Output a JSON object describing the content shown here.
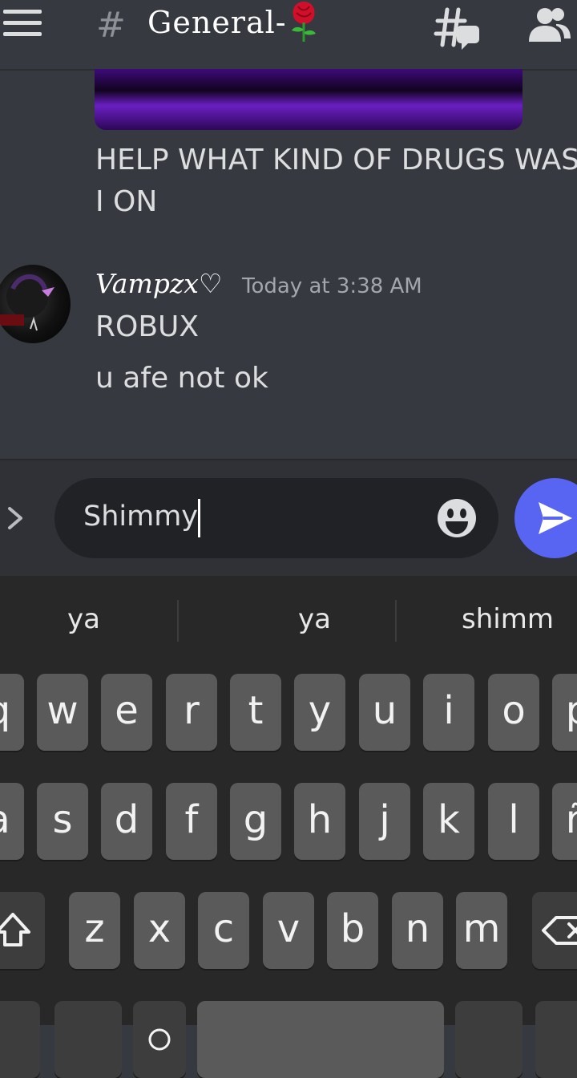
{
  "header": {
    "hash_symbol": "#",
    "channel_name": "General-",
    "rose_icon": "rose-emoji",
    "threads_icon": "threads-icon",
    "members_icon": "members-icon"
  },
  "messages": {
    "prev_line1": "HELP WHAT KIND OF DRUGS WAS",
    "prev_line2": "I ON",
    "author": "Vampzx♡",
    "timestamp": "Today at 3:38 AM",
    "line1": "ROBUX",
    "line2": "u afe not ok"
  },
  "composer": {
    "text": "Shimmy",
    "emoji_icon": "smile-icon",
    "send_icon": "send-icon"
  },
  "keyboard": {
    "suggestions": [
      "ya",
      "ya",
      "shimm"
    ],
    "row1": [
      "q",
      "w",
      "e",
      "r",
      "t",
      "y",
      "u",
      "i",
      "o",
      "p"
    ],
    "row2": [
      "a",
      "s",
      "d",
      "f",
      "g",
      "h",
      "j",
      "k",
      "l",
      "ñ"
    ],
    "row3": [
      "z",
      "x",
      "c",
      "v",
      "b",
      "n",
      "m"
    ]
  },
  "colors": {
    "background": "#36393f",
    "composer_bg": "#2f3136",
    "input_bg": "#202225",
    "send_accent": "#5865f2",
    "keyboard_bg": "#282828",
    "key_bg": "#5a5a5a"
  }
}
